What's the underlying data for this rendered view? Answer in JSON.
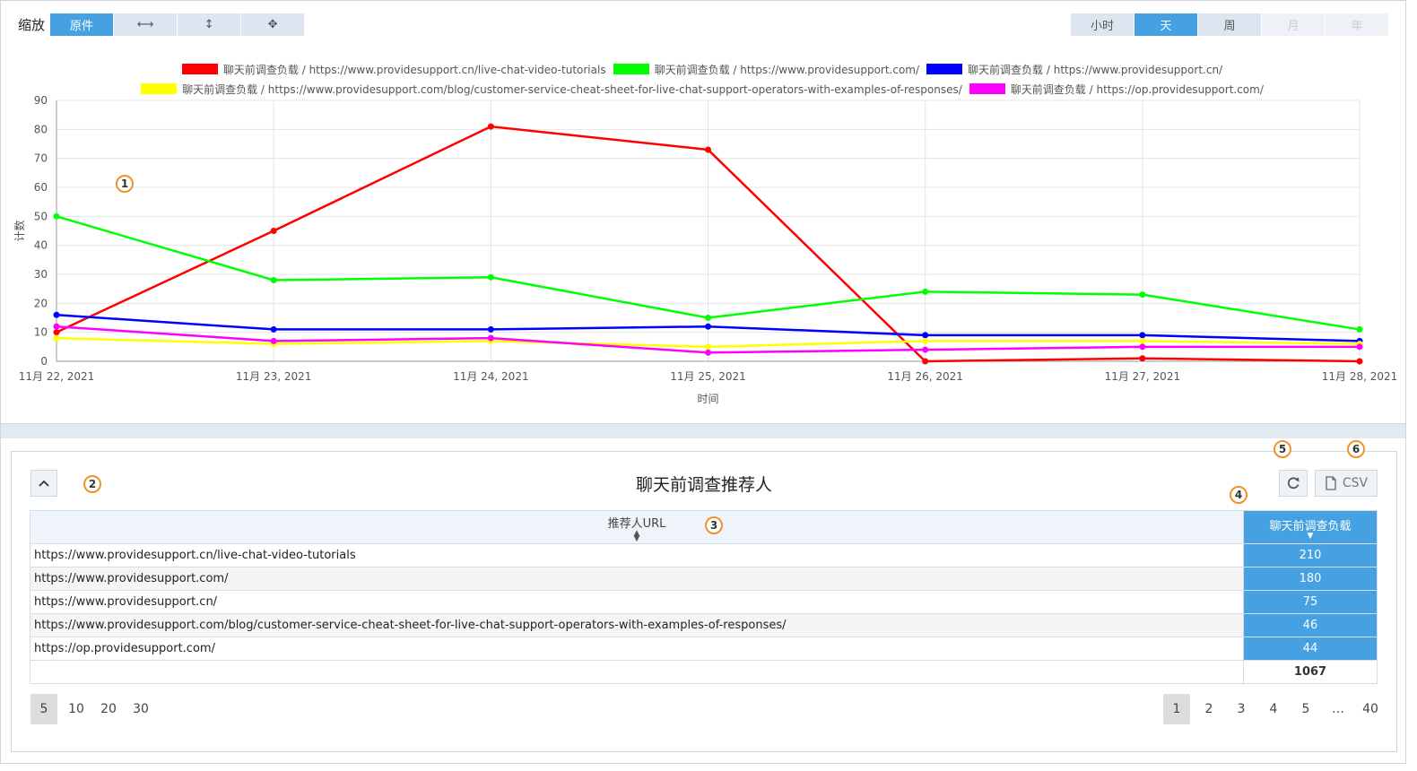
{
  "toolbar": {
    "zoom_label": "缩放",
    "zoom_buttons": [
      {
        "label": "原件",
        "state": "active"
      },
      {
        "label": "⟷",
        "icon": "horizontal-zoom-icon"
      },
      {
        "label": "↕",
        "icon": "vertical-zoom-icon"
      },
      {
        "label": "✥",
        "icon": "pan-icon"
      }
    ],
    "period_buttons": [
      {
        "label": "小时",
        "state": "normal"
      },
      {
        "label": "天",
        "state": "active"
      },
      {
        "label": "周",
        "state": "normal"
      },
      {
        "label": "月",
        "state": "disabled"
      },
      {
        "label": "年",
        "state": "disabled"
      }
    ]
  },
  "chart_data": {
    "type": "line",
    "x": [
      "11月 22, 2021",
      "11月 23, 2021",
      "11月 24, 2021",
      "11月 25, 2021",
      "11月 26, 2021",
      "11月 27, 2021",
      "11月 28, 2021"
    ],
    "xlabel": "时间",
    "ylabel": "计数",
    "ylim": [
      0,
      90
    ],
    "yticks": [
      0,
      10,
      20,
      30,
      40,
      50,
      60,
      70,
      80,
      90
    ],
    "grid": true,
    "legend_position": "top-center",
    "series": [
      {
        "name": "聊天前调查负载 / https://www.providesupport.cn/live-chat-video-tutorials",
        "color": "#ff0000",
        "values": [
          10,
          45,
          81,
          73,
          0,
          1,
          0
        ]
      },
      {
        "name": "聊天前调查负载 / https://www.providesupport.com/",
        "color": "#00ff00",
        "values": [
          50,
          28,
          29,
          15,
          24,
          23,
          11
        ]
      },
      {
        "name": "聊天前调查负载 / https://www.providesupport.cn/",
        "color": "#0000ff",
        "values": [
          16,
          11,
          11,
          12,
          9,
          9,
          7
        ]
      },
      {
        "name": "聊天前调查负载 / https://www.providesupport.com/blog/customer-service-cheat-sheet-for-live-chat-support-operators-with-examples-of-responses/",
        "color": "#ffff00",
        "values": [
          8,
          6,
          7,
          5,
          7,
          7,
          6
        ]
      },
      {
        "name": "聊天前调查负载 / https://op.providesupport.com/",
        "color": "#ff00ff",
        "values": [
          12,
          7,
          8,
          3,
          4,
          5,
          5
        ]
      }
    ]
  },
  "panel": {
    "title": "聊天前调查推荐人",
    "csv_label": "CSV",
    "table": {
      "col_url": "推荐人URL",
      "col_metric": "聊天前调查负载",
      "rows": [
        {
          "url": "https://www.providesupport.cn/live-chat-video-tutorials",
          "value": "210"
        },
        {
          "url": "https://www.providesupport.com/",
          "value": "180"
        },
        {
          "url": "https://www.providesupport.cn/",
          "value": "75"
        },
        {
          "url": "https://www.providesupport.com/blog/customer-service-cheat-sheet-for-live-chat-support-operators-with-examples-of-responses/",
          "value": "46"
        },
        {
          "url": "https://op.providesupport.com/",
          "value": "44"
        }
      ],
      "total": "1067"
    },
    "page_sizes": [
      "5",
      "10",
      "20",
      "30"
    ],
    "pages": [
      "1",
      "2",
      "3",
      "4",
      "5",
      "…",
      "40"
    ]
  },
  "annotations": [
    "1",
    "2",
    "3",
    "4",
    "5",
    "6"
  ]
}
